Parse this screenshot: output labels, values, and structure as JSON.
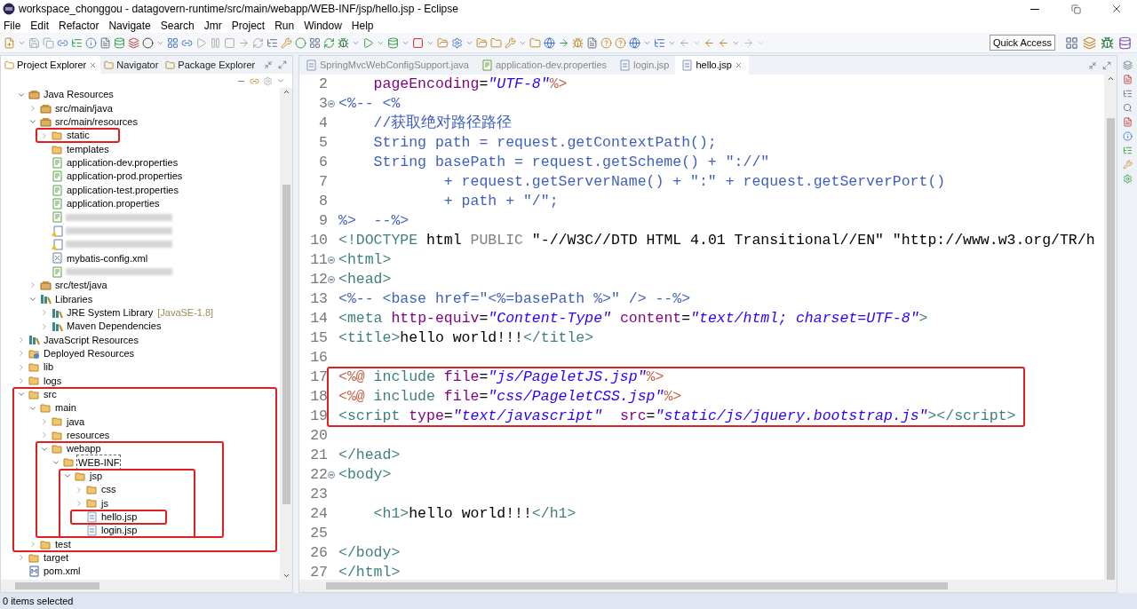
{
  "window": {
    "title": "workspace_chonggou - datagovern-runtime/src/main/webapp/WEB-INF/jsp/hello.jsp - Eclipse"
  },
  "menu": [
    "File",
    "Edit",
    "Refactor",
    "Navigate",
    "Search",
    "Jmr",
    "Project",
    "Run",
    "Window",
    "Help"
  ],
  "toolbar": {
    "quick_access": "Quick Access"
  },
  "explorer": {
    "tabs": [
      {
        "label": "Project Explorer",
        "selected": true
      },
      {
        "label": "Navigator",
        "selected": false
      },
      {
        "label": "Package Explorer",
        "selected": false
      }
    ],
    "tree": [
      {
        "label": "Java Resources",
        "kind": "resources",
        "expanded": true,
        "children": [
          {
            "label": "src/main/java",
            "kind": "package-root",
            "expanded": false
          },
          {
            "label": "src/main/resources",
            "kind": "package-root",
            "expanded": true,
            "children": [
              {
                "label": "static",
                "kind": "folder",
                "expanded": false,
                "highlighted": true
              },
              {
                "label": "templates",
                "kind": "folder"
              },
              {
                "label": "application-dev.properties",
                "kind": "properties"
              },
              {
                "label": "application-prod.properties",
                "kind": "properties"
              },
              {
                "label": "application-test.properties",
                "kind": "properties"
              },
              {
                "label": "application.properties",
                "kind": "properties"
              },
              {
                "kind": "properties",
                "redacted": true
              },
              {
                "kind": "xml-warning",
                "redacted": true
              },
              {
                "kind": "xml-warning",
                "redacted": true
              },
              {
                "label": "mybatis-config.xml",
                "kind": "xml"
              },
              {
                "kind": "properties",
                "redacted": true
              }
            ]
          },
          {
            "label": "src/test/java",
            "kind": "package-root",
            "expanded": false
          },
          {
            "label": "Libraries",
            "kind": "library",
            "expanded": true,
            "children": [
              {
                "label": "JRE System Library",
                "decoration": "[JavaSE-1.8]",
                "kind": "library",
                "expanded": false
              },
              {
                "label": "Maven Dependencies",
                "kind": "library",
                "expanded": false
              }
            ]
          }
        ]
      },
      {
        "label": "JavaScript Resources",
        "kind": "library",
        "expanded": false
      },
      {
        "label": "Deployed Resources",
        "kind": "deployed",
        "expanded": false
      },
      {
        "label": "lib",
        "kind": "folder",
        "expanded": false
      },
      {
        "label": "logs",
        "kind": "folder",
        "expanded": false
      },
      {
        "label": "src",
        "kind": "folder",
        "expanded": true,
        "highlighted": true,
        "children": [
          {
            "label": "main",
            "kind": "folder",
            "expanded": true,
            "children": [
              {
                "label": "java",
                "kind": "folder",
                "expanded": false
              },
              {
                "label": "resources",
                "kind": "folder",
                "expanded": false
              },
              {
                "label": "webapp",
                "kind": "folder",
                "expanded": true,
                "highlighted": true,
                "children": [
                  {
                    "label": "WEB-INF",
                    "kind": "folder",
                    "expanded": true,
                    "focused": true,
                    "children": [
                      {
                        "label": "jsp",
                        "kind": "folder",
                        "expanded": true,
                        "highlighted": true,
                        "children": [
                          {
                            "label": "css",
                            "kind": "folder",
                            "expanded": false
                          },
                          {
                            "label": "js",
                            "kind": "folder",
                            "expanded": false
                          },
                          {
                            "label": "hello.jsp",
                            "kind": "jsp",
                            "highlighted": true
                          },
                          {
                            "label": "login.jsp",
                            "kind": "jsp"
                          }
                        ]
                      }
                    ]
                  }
                ]
              }
            ]
          },
          {
            "label": "test",
            "kind": "folder",
            "expanded": false
          }
        ]
      },
      {
        "label": "target",
        "kind": "folder",
        "expanded": false
      },
      {
        "label": "pom.xml",
        "kind": "pom"
      }
    ]
  },
  "editor": {
    "tabs": [
      {
        "label": "SpringMvcWebConfigSupport.java",
        "kind": "java",
        "selected": false
      },
      {
        "label": "application-dev.properties",
        "kind": "properties",
        "selected": false
      },
      {
        "label": "login.jsp",
        "kind": "jsp",
        "selected": false
      },
      {
        "label": "hello.jsp",
        "kind": "jsp",
        "selected": true
      }
    ],
    "lines": [
      {
        "number": "2",
        "fold": false,
        "highlighted": false,
        "tokens": [
          {
            "kind": "attr",
            "text": "    pageEncoding"
          },
          {
            "kind": "plain",
            "text": "="
          },
          {
            "kind": "string",
            "text": "\"UTF-8\""
          },
          {
            "kind": "jsp",
            "text": "%>"
          }
        ]
      },
      {
        "number": "3",
        "fold": true,
        "highlighted": false,
        "tokens": [
          {
            "kind": "comment",
            "text": "<%-- <%"
          }
        ]
      },
      {
        "number": "4",
        "fold": false,
        "highlighted": false,
        "tokens": [
          {
            "kind": "comment",
            "text": "    //获取绝对路径路径"
          }
        ]
      },
      {
        "number": "5",
        "fold": false,
        "highlighted": false,
        "tokens": [
          {
            "kind": "comment",
            "text": "    String path = request.getContextPath();"
          }
        ]
      },
      {
        "number": "6",
        "fold": false,
        "highlighted": false,
        "tokens": [
          {
            "kind": "comment",
            "text": "    String basePath = request.getScheme() + \"://\""
          }
        ]
      },
      {
        "number": "7",
        "fold": false,
        "highlighted": false,
        "tokens": [
          {
            "kind": "comment",
            "text": "            + request.getServerName() + \":\" + request.getServerPort()"
          }
        ]
      },
      {
        "number": "8",
        "fold": false,
        "highlighted": false,
        "tokens": [
          {
            "kind": "comment",
            "text": "            + path + \"/\";"
          }
        ]
      },
      {
        "number": "9",
        "fold": false,
        "highlighted": false,
        "tokens": [
          {
            "kind": "comment",
            "text": "%>  --%>"
          }
        ]
      },
      {
        "number": "10",
        "fold": false,
        "highlighted": false,
        "tokens": [
          {
            "kind": "tag",
            "text": "<!DOCTYPE"
          },
          {
            "kind": "plain",
            "text": " html "
          },
          {
            "kind": "keyword",
            "text": "PUBLIC"
          },
          {
            "kind": "plain",
            "text": " \"-//W3C//DTD HTML 4.01 Transitional//EN\" \"http://www.w3.org/TR/h"
          }
        ]
      },
      {
        "number": "11",
        "fold": true,
        "highlighted": false,
        "tokens": [
          {
            "kind": "tag",
            "text": "<html>"
          }
        ]
      },
      {
        "number": "12",
        "fold": true,
        "highlighted": false,
        "tokens": [
          {
            "kind": "tag",
            "text": "<head>"
          }
        ]
      },
      {
        "number": "13",
        "fold": false,
        "highlighted": false,
        "tokens": [
          {
            "kind": "comment",
            "text": "<%-- <base href=\"<%=basePath %>\" /> --%>"
          }
        ]
      },
      {
        "number": "14",
        "fold": false,
        "highlighted": false,
        "tokens": [
          {
            "kind": "tag",
            "text": "<meta "
          },
          {
            "kind": "attr",
            "text": "http-equiv"
          },
          {
            "kind": "plain",
            "text": "="
          },
          {
            "kind": "string",
            "text": "\"Content-Type\" "
          },
          {
            "kind": "attr",
            "text": "content"
          },
          {
            "kind": "plain",
            "text": "="
          },
          {
            "kind": "string",
            "text": "\"text/html; charset=UTF-8\""
          },
          {
            "kind": "tag",
            "text": ">"
          }
        ]
      },
      {
        "number": "15",
        "fold": false,
        "highlighted": false,
        "tokens": [
          {
            "kind": "tag",
            "text": "<title>"
          },
          {
            "kind": "plain",
            "text": "hello world!!!"
          },
          {
            "kind": "tag",
            "text": "</title>"
          }
        ]
      },
      {
        "number": "16",
        "fold": false,
        "highlighted": false
      },
      {
        "number": "17",
        "fold": false,
        "highlighted": true,
        "tokens": [
          {
            "kind": "jsp",
            "text": "<%@ "
          },
          {
            "kind": "tag",
            "text": "include "
          },
          {
            "kind": "attr",
            "text": "file"
          },
          {
            "kind": "plain",
            "text": "="
          },
          {
            "kind": "string",
            "text": "\"js/PageletJS.jsp\""
          },
          {
            "kind": "jsp",
            "text": "%>"
          }
        ]
      },
      {
        "number": "18",
        "fold": false,
        "highlighted": true,
        "tokens": [
          {
            "kind": "jsp",
            "text": "<%@ "
          },
          {
            "kind": "tag",
            "text": "include "
          },
          {
            "kind": "attr",
            "text": "file"
          },
          {
            "kind": "plain",
            "text": "="
          },
          {
            "kind": "string",
            "text": "\"css/PageletCSS.jsp\""
          },
          {
            "kind": "jsp",
            "text": "%>"
          }
        ]
      },
      {
        "number": "19",
        "fold": false,
        "highlighted": true,
        "tokens": [
          {
            "kind": "tag",
            "text": "<script "
          },
          {
            "kind": "attr",
            "text": "type"
          },
          {
            "kind": "plain",
            "text": "="
          },
          {
            "kind": "string",
            "text": "\"text/javascript\"  "
          },
          {
            "kind": "attr",
            "text": "src"
          },
          {
            "kind": "plain",
            "text": "="
          },
          {
            "kind": "string",
            "text": "\"static/js/jquery.bootstrap.js\""
          },
          {
            "kind": "tag",
            "text": "></script>"
          }
        ]
      },
      {
        "number": "20",
        "fold": false,
        "highlighted": false
      },
      {
        "number": "21",
        "fold": false,
        "highlighted": false,
        "tokens": [
          {
            "kind": "tag",
            "text": "</head>"
          }
        ]
      },
      {
        "number": "22",
        "fold": true,
        "highlighted": false,
        "tokens": [
          {
            "kind": "tag",
            "text": "<body>"
          }
        ]
      },
      {
        "number": "23",
        "fold": false,
        "highlighted": false
      },
      {
        "number": "24",
        "fold": false,
        "highlighted": false,
        "tokens": [
          {
            "kind": "tag",
            "text": "    <h1>"
          },
          {
            "kind": "plain",
            "text": "hello world!!!"
          },
          {
            "kind": "tag",
            "text": "</h1>"
          }
        ]
      },
      {
        "number": "25",
        "fold": false,
        "highlighted": false
      },
      {
        "number": "26",
        "fold": false,
        "highlighted": false,
        "tokens": [
          {
            "kind": "tag",
            "text": "</body>"
          }
        ]
      },
      {
        "number": "27",
        "fold": false,
        "highlighted": false,
        "tokens": [
          {
            "kind": "tag",
            "text": "</html>"
          }
        ]
      }
    ]
  },
  "status_bar": {
    "text": "0 items selected"
  }
}
